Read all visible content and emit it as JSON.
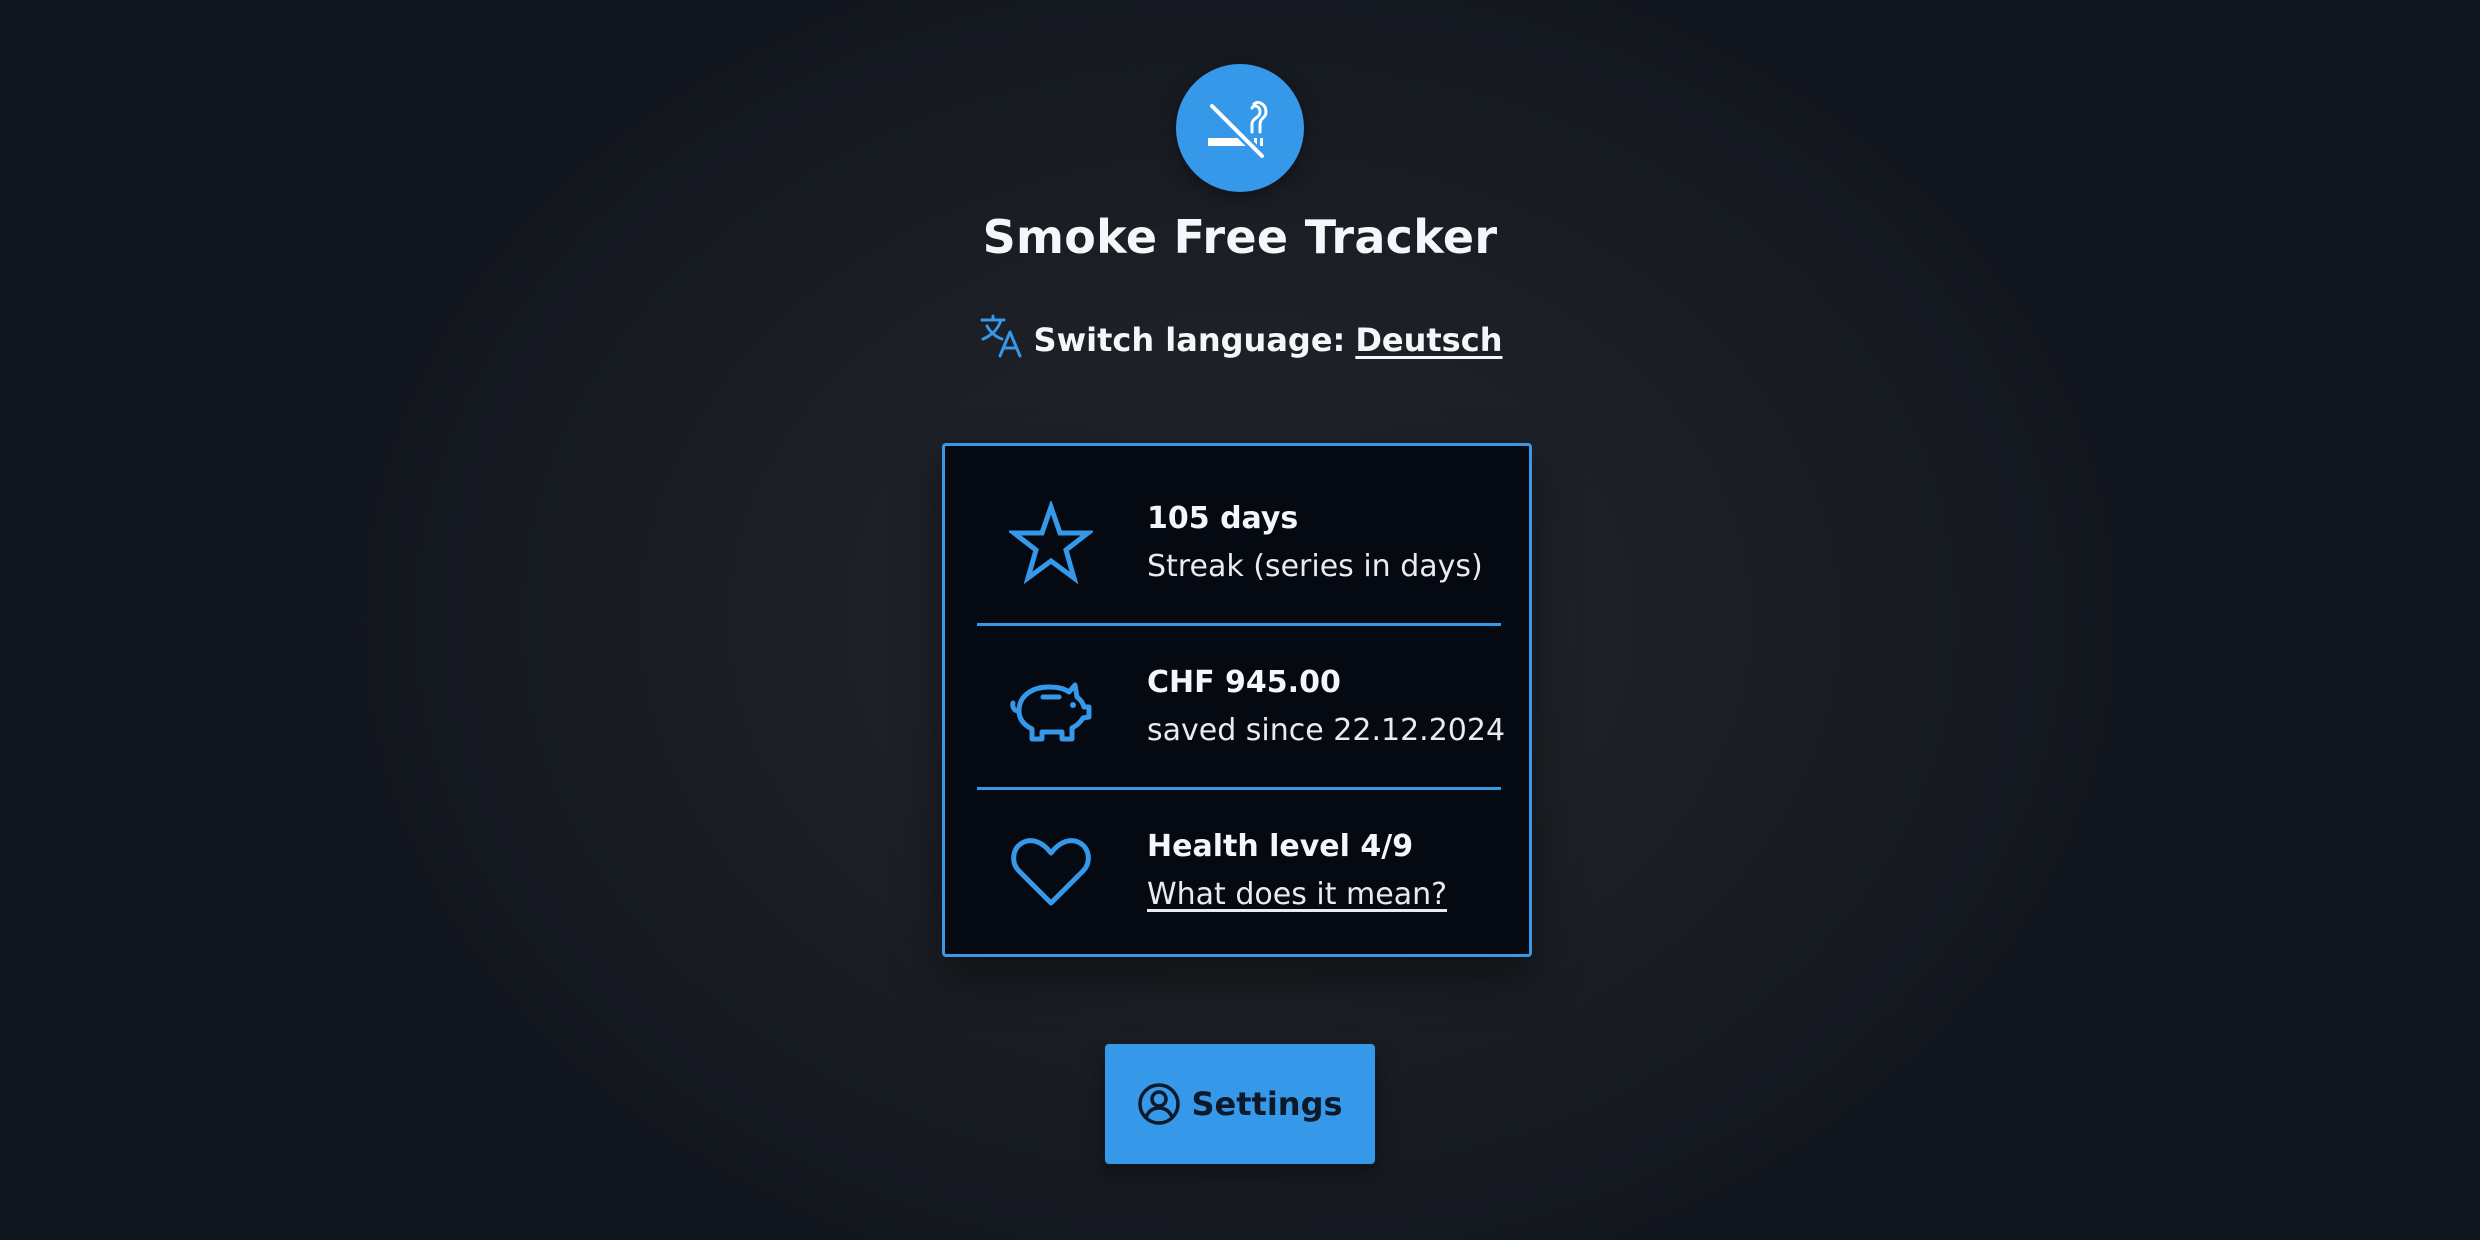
{
  "app": {
    "title": "Smoke Free Tracker",
    "logo_icon": "no-smoking-icon"
  },
  "language": {
    "prefix": "Switch language:",
    "link": "Deutsch",
    "icon": "translate-icon"
  },
  "stats": [
    {
      "icon": "star-icon",
      "value": "105 days",
      "label": "Streak (series in days)"
    },
    {
      "icon": "piggy-bank-icon",
      "value": "CHF 945.00",
      "label": "saved since 22.12.2024"
    },
    {
      "icon": "heart-icon",
      "value": "Health level 4/9",
      "link": "What does it mean?"
    }
  ],
  "settings": {
    "label": "Settings",
    "icon": "user-circle-icon"
  },
  "colors": {
    "accent": "#3598e8",
    "background": "#1b1e24",
    "card_background": "#050912",
    "text": "#f4f6f9"
  }
}
